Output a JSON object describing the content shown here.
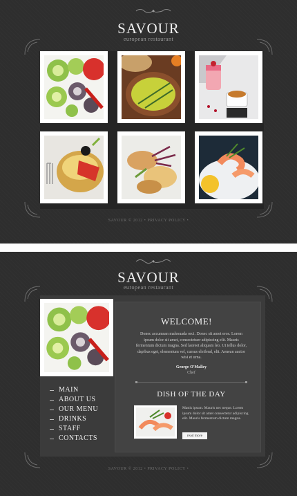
{
  "site": {
    "title": "SAVOUR",
    "subtitle": "european restaurant"
  },
  "footer": {
    "text": "SAVOUR © 2012 • PRIVACY POLICY •"
  },
  "gallery": {
    "tiles": [
      {
        "icon": "salad-photo"
      },
      {
        "icon": "soup-photo"
      },
      {
        "icon": "dessert-photo"
      },
      {
        "icon": "cake-photo"
      },
      {
        "icon": "pasta-photo"
      },
      {
        "icon": "shrimp-photo"
      }
    ]
  },
  "menu": {
    "items": [
      {
        "label": "MAIN"
      },
      {
        "label": "ABOUT US"
      },
      {
        "label": "OUR MENU"
      },
      {
        "label": "DRINKS"
      },
      {
        "label": "STAFF"
      },
      {
        "label": "CONTACTS"
      }
    ]
  },
  "welcome": {
    "heading": "WELCOME!",
    "body": "Donec accumsan malesuada orci. Donec sit amet eros. Lorem ipsum dolor sit amet, consectetuer adipiscing elit. Mauris fermentum dictum magna. Sed laoreet aliquam leo. Ut tellus dolor, dapibus eget, elementum vel, cursus eleifend, elit. Aenean auctor wisi et urna.",
    "signature_name": "George O'Malley",
    "signature_role": "Chef"
  },
  "dish_of_day": {
    "heading": "DISH OF THE DAY",
    "body": "Mattis ipsum. Mauris nec neque. Lorem ipsum dolor sit amet consectetur adipiscing elit. Mauris fermentum dictum magna.",
    "button_label": "read more"
  },
  "colors": {
    "background": "#2e2e2e",
    "frame": "#3b3b3b",
    "text": "#f2f2f2",
    "accent": "#ffffff"
  }
}
